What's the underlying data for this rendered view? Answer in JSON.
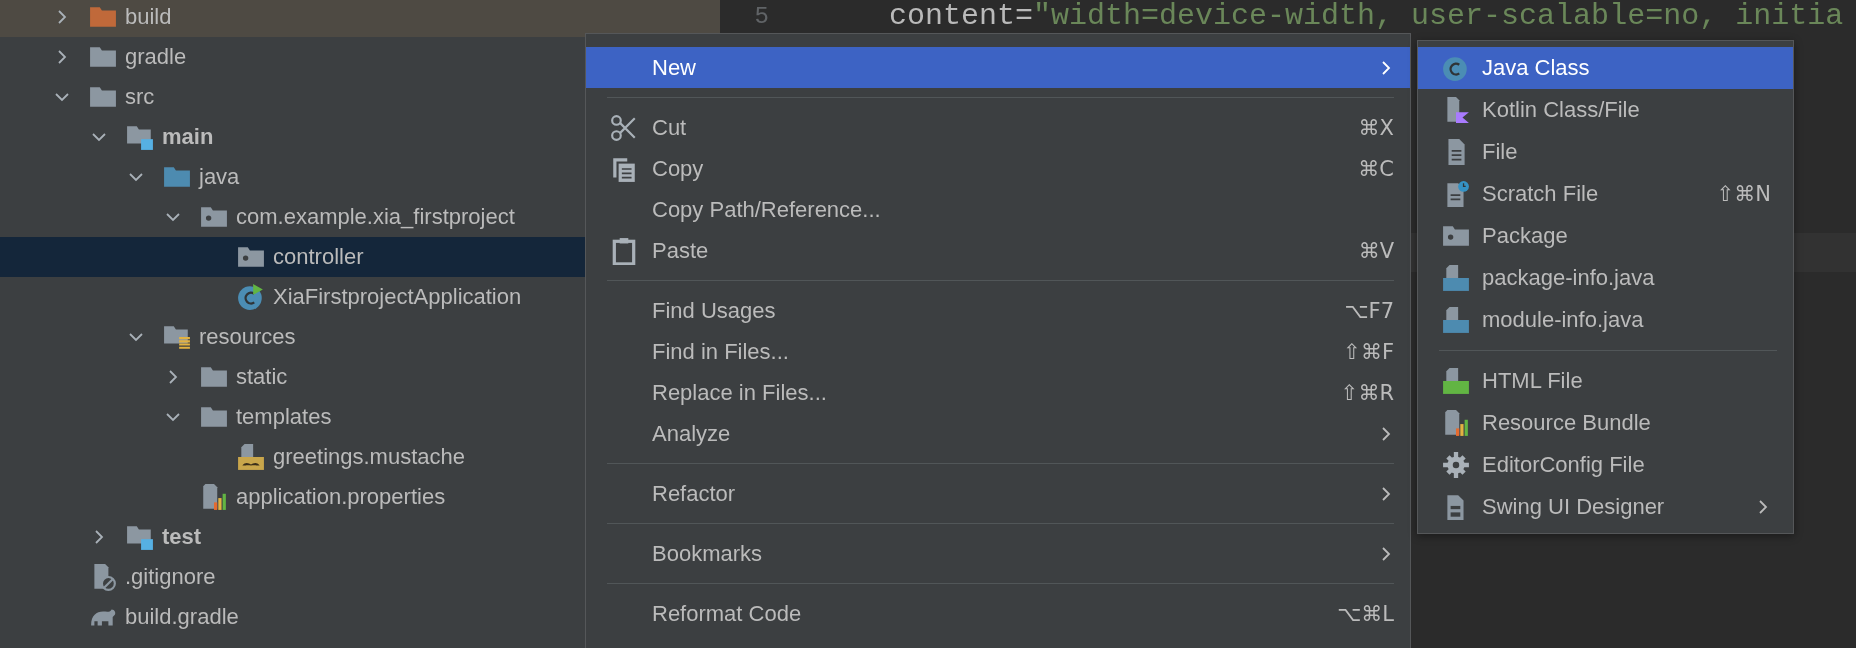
{
  "project_tree": {
    "items": [
      {
        "label": "build",
        "kind": "excluded",
        "expanded": false,
        "selected": false
      },
      {
        "label": "gradle",
        "kind": "folder",
        "expanded": false,
        "selected": false
      },
      {
        "label": "src",
        "kind": "folder",
        "expanded": true,
        "selected": false,
        "children": [
          {
            "label": "main",
            "kind": "root",
            "expanded": true,
            "selected": false,
            "children": [
              {
                "label": "java",
                "kind": "sources",
                "expanded": true,
                "selected": false,
                "children": [
                  {
                    "label": "com.example.xia_firstproject",
                    "kind": "package",
                    "expanded": true,
                    "selected": false,
                    "children": [
                      {
                        "label": "controller",
                        "kind": "package",
                        "selected": true
                      },
                      {
                        "label": "XiaFirstprojectApplication",
                        "kind": "application",
                        "selected": false
                      }
                    ]
                  }
                ]
              },
              {
                "label": "resources",
                "kind": "resources",
                "expanded": true,
                "selected": false,
                "children": [
                  {
                    "label": "static",
                    "kind": "folder",
                    "expanded": false,
                    "selected": false
                  },
                  {
                    "label": "templates",
                    "kind": "folder",
                    "expanded": true,
                    "selected": false,
                    "children": [
                      {
                        "label": "greetings.mustache",
                        "kind": "mustache",
                        "selected": false
                      }
                    ]
                  },
                  {
                    "label": "application.properties",
                    "kind": "properties",
                    "selected": false
                  }
                ]
              }
            ]
          },
          {
            "label": "test",
            "kind": "root",
            "expanded": false,
            "selected": false
          }
        ]
      },
      {
        "label": ".gitignore",
        "kind": "ignore",
        "selected": false
      },
      {
        "label": "build.gradle",
        "kind": "gradle",
        "selected": false
      }
    ]
  },
  "editor": {
    "lines": [
      {
        "number": "5",
        "segments": [
          {
            "kind": "attribute",
            "text": "content="
          },
          {
            "kind": "string",
            "text": "\"width=device-width, user-scalable=no, initia"
          }
        ]
      }
    ]
  },
  "context_menu": {
    "items": [
      {
        "kind": "plain",
        "label": "New",
        "submenu": true,
        "selected": true
      },
      {
        "kind": "separator"
      },
      {
        "kind": "scissors",
        "label": "Cut",
        "shortcut": "⌘X",
        "submenu": false,
        "selected": false
      },
      {
        "kind": "copy",
        "label": "Copy",
        "shortcut": "⌘C",
        "submenu": false,
        "selected": false
      },
      {
        "kind": "plain",
        "label": "Copy Path/Reference...",
        "submenu": false,
        "selected": false
      },
      {
        "kind": "paste",
        "label": "Paste",
        "shortcut": "⌘V",
        "submenu": false,
        "selected": false
      },
      {
        "kind": "separator"
      },
      {
        "kind": "plain",
        "label": "Find Usages",
        "shortcut": "⌥F7",
        "submenu": false,
        "selected": false
      },
      {
        "kind": "plain",
        "label": "Find in Files...",
        "shortcut": "⇧⌘F",
        "submenu": false,
        "selected": false
      },
      {
        "kind": "plain",
        "label": "Replace in Files...",
        "shortcut": "⇧⌘R",
        "submenu": false,
        "selected": false
      },
      {
        "kind": "plain",
        "label": "Analyze",
        "submenu": true,
        "selected": false
      },
      {
        "kind": "separator"
      },
      {
        "kind": "plain",
        "label": "Refactor",
        "submenu": true,
        "selected": false
      },
      {
        "kind": "separator"
      },
      {
        "kind": "plain",
        "label": "Bookmarks",
        "submenu": true,
        "selected": false
      },
      {
        "kind": "separator"
      },
      {
        "kind": "plain",
        "label": "Reformat Code",
        "shortcut": "⌥⌘L",
        "submenu": false,
        "selected": false
      }
    ]
  },
  "new_submenu": {
    "items": [
      {
        "kind": "class",
        "label": "Java Class",
        "submenu": false,
        "selected": true
      },
      {
        "kind": "kotlin",
        "label": "Kotlin Class/File",
        "submenu": false,
        "selected": false
      },
      {
        "kind": "file",
        "label": "File",
        "submenu": false,
        "selected": false
      },
      {
        "kind": "scratch",
        "label": "Scratch File",
        "shortcut": "⇧⌘N",
        "submenu": false,
        "selected": false
      },
      {
        "kind": "package",
        "label": "Package",
        "submenu": false,
        "selected": false
      },
      {
        "kind": "java",
        "label": "package-info.java",
        "submenu": false,
        "selected": false
      },
      {
        "kind": "java",
        "label": "module-info.java",
        "submenu": false,
        "selected": false
      },
      {
        "kind": "separator"
      },
      {
        "kind": "html",
        "label": "HTML File",
        "submenu": false,
        "selected": false
      },
      {
        "kind": "properties",
        "label": "Resource Bundle",
        "submenu": false,
        "selected": false
      },
      {
        "kind": "gear",
        "label": "EditorConfig File",
        "submenu": false,
        "selected": false
      },
      {
        "kind": "form",
        "label": "Swing UI Designer",
        "submenu": true,
        "selected": false
      }
    ]
  }
}
